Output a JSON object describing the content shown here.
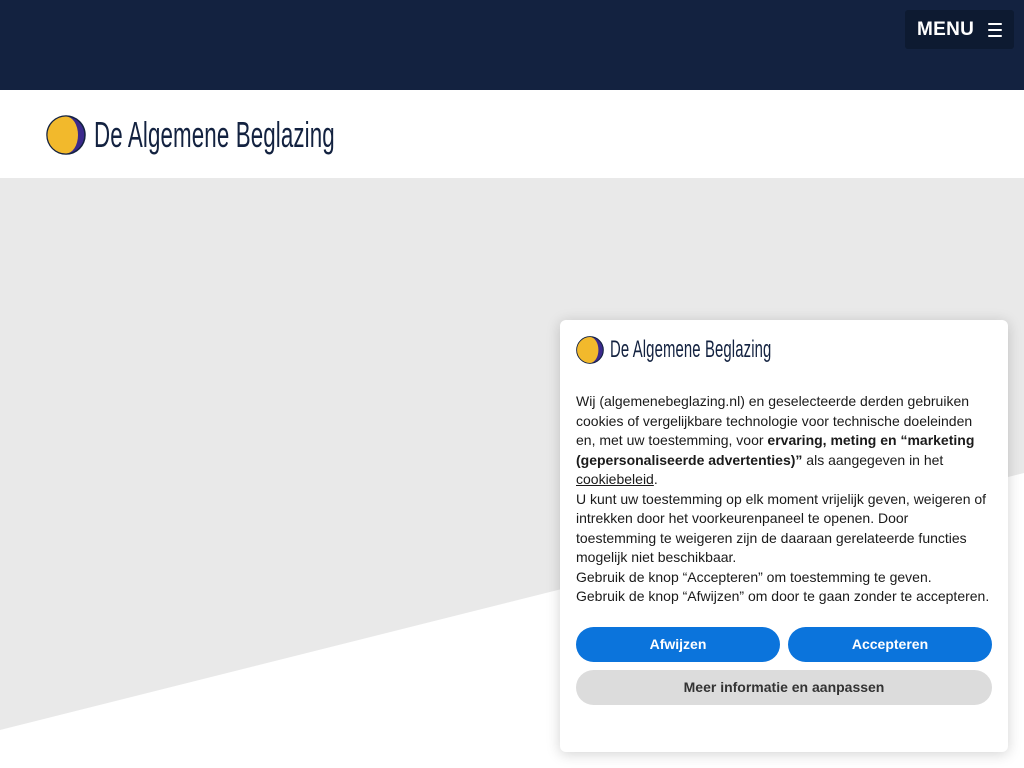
{
  "topbar": {
    "menu_label": "MENU",
    "menu_icon": "hamburger-icon"
  },
  "brand": {
    "name": "De Algemene Beglazing",
    "logo_icon": "moon-logo-icon",
    "colors": {
      "navy": "#132240",
      "gold": "#f2b92c",
      "purple": "#3b2a8c"
    }
  },
  "cookie_banner": {
    "intro_start": "Wij (algemenebeglazing.nl) en geselecteerde derden gebruiken cookies of vergelijkbare technologie voor technische doeleinden en, met uw toestemming, voor ",
    "intro_bold": "ervaring, meting en “marketing (gepersonaliseerde advertenties)”",
    "intro_end": " als aangegeven in het ",
    "policy_link": "cookiebeleid",
    "intro_period": ".",
    "paragraph_2": "U kunt uw toestemming op elk moment vrijelijk geven, weigeren of intrekken door het voorkeurenpaneel te openen. Door toestemming te weigeren zijn de daaraan gerelateerde functies mogelijk niet beschikbaar.",
    "paragraph_3": "Gebruik de knop “Accepteren” om toestemming te geven.",
    "paragraph_4": "Gebruik de knop “Afwijzen” om door te gaan zonder te accepteren.",
    "reject_label": "Afwijzen",
    "accept_label": "Accepteren",
    "more_label": "Meer informatie en aanpassen",
    "colors": {
      "primary_button": "#0b74dc",
      "secondary_button": "#dcdcdc"
    }
  }
}
